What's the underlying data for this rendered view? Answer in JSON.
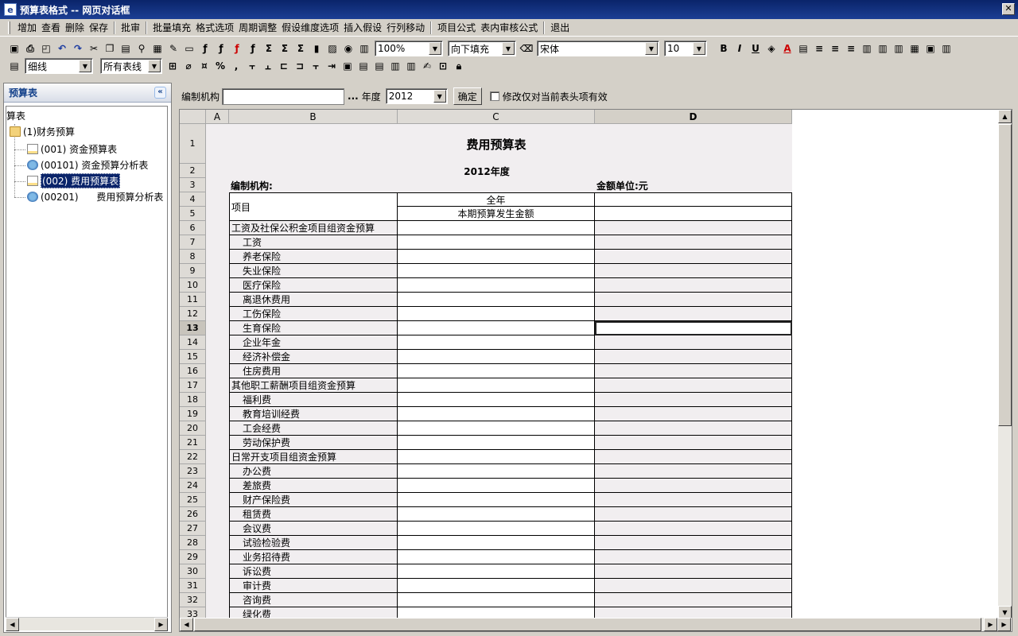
{
  "window": {
    "title": "预算表格式 -- 网页对话框",
    "close": "✕"
  },
  "menu": {
    "group1": [
      "增加",
      "查看",
      "删除",
      "保存"
    ],
    "group2": [
      "批审"
    ],
    "group3": [
      "批量填充",
      "格式选项",
      "周期调整",
      "假设维度选项",
      "插入假设",
      "行列移动"
    ],
    "group4": [
      "项目公式",
      "表内审核公式"
    ],
    "group5": [
      "退出"
    ]
  },
  "toolbar": {
    "zoom": "100%",
    "fill": "向下填充",
    "font": "宋体",
    "font_size": "10",
    "line_style": "细线",
    "border_scope": "所有表线",
    "bold": "B",
    "italic": "I",
    "underline": "U",
    "font_color": "A"
  },
  "left": {
    "title": "预算表",
    "collapse": "«",
    "tree": {
      "root": "算表",
      "folder": "(1)财务预算",
      "items": [
        "(001) 资金预算表",
        "(00101) 资金预算分析表",
        "(002) 费用预算表",
        "(00201)      费用预算分析表"
      ]
    }
  },
  "filter": {
    "org_label": "编制机构",
    "org_value": "",
    "browse": "...",
    "year_label": "年度",
    "year_value": "2012",
    "confirm": "确定",
    "checkbox_label": "修改仅对当前表头项有效"
  },
  "sheet": {
    "columns": [
      "A",
      "B",
      "C",
      "D"
    ],
    "title": "费用预算表",
    "year": "2012年度",
    "org": "编制机构:",
    "unit": "金额单位:元",
    "col_header_item": "项目",
    "col_header_year": "全年",
    "col_header_amount": "本期预算发生金额",
    "rows": [
      {
        "n": "1"
      },
      {
        "n": "2"
      },
      {
        "n": "3"
      },
      {
        "n": "4"
      },
      {
        "n": "5"
      },
      {
        "n": "6",
        "label": "工资及社保公积金项目组资金预算",
        "group": true
      },
      {
        "n": "7",
        "label": "工资"
      },
      {
        "n": "8",
        "label": "养老保险"
      },
      {
        "n": "9",
        "label": "失业保险"
      },
      {
        "n": "10",
        "label": "医疗保险"
      },
      {
        "n": "11",
        "label": "离退休费用"
      },
      {
        "n": "12",
        "label": "工伤保险"
      },
      {
        "n": "13",
        "label": "生育保险"
      },
      {
        "n": "14",
        "label": "企业年金"
      },
      {
        "n": "15",
        "label": "经济补偿金"
      },
      {
        "n": "16",
        "label": "住房费用"
      },
      {
        "n": "17",
        "label": "其他职工薪酬项目组资金预算",
        "group": true
      },
      {
        "n": "18",
        "label": "福利费"
      },
      {
        "n": "19",
        "label": "教育培训经费"
      },
      {
        "n": "20",
        "label": "工会经费"
      },
      {
        "n": "21",
        "label": "劳动保护费"
      },
      {
        "n": "22",
        "label": "日常开支项目组资金预算",
        "group": true
      },
      {
        "n": "23",
        "label": "办公费"
      },
      {
        "n": "24",
        "label": "差旅费"
      },
      {
        "n": "25",
        "label": "财产保险费"
      },
      {
        "n": "26",
        "label": "租赁费"
      },
      {
        "n": "27",
        "label": "会议费"
      },
      {
        "n": "28",
        "label": "试验检验费"
      },
      {
        "n": "29",
        "label": "业务招待费"
      },
      {
        "n": "30",
        "label": "诉讼费"
      },
      {
        "n": "31",
        "label": "审计费"
      },
      {
        "n": "32",
        "label": "咨询费"
      },
      {
        "n": "33",
        "label": "绿化费"
      }
    ],
    "active_row": "13",
    "active_col": "D"
  }
}
